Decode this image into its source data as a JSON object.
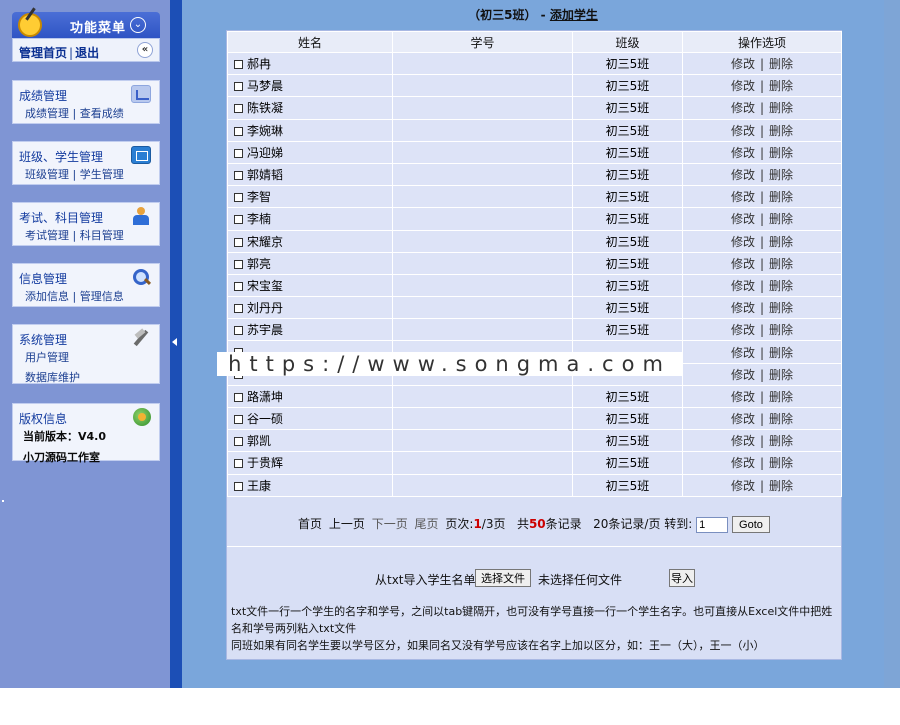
{
  "sidebar": {
    "menu_title": "功能菜单",
    "nav": {
      "home": "管理首页",
      "logout": "退出"
    },
    "panels": [
      {
        "title": "成绩管理",
        "links": [
          "成绩管理",
          "查看成绩"
        ],
        "icon": "chart-icon"
      },
      {
        "title": "班级、学生管理",
        "links": [
          "班级管理",
          "学生管理"
        ],
        "icon": "edit-icon"
      },
      {
        "title": "考试、科目管理",
        "links": [
          "考试管理",
          "科目管理"
        ],
        "icon": "teacher-icon"
      },
      {
        "title": "信息管理",
        "links": [
          "添加信息",
          "管理信息"
        ],
        "icon": "search-icon"
      },
      {
        "title": "系统管理",
        "links": [
          "用户管理",
          "数据库维护"
        ],
        "icon": "tools-icon"
      },
      {
        "title": "版权信息",
        "links": [
          "当前版本：V4.0",
          "小刀源码工作室"
        ],
        "icon": "globe-icon"
      }
    ]
  },
  "main": {
    "class_name": "（初三5班）",
    "separator": "-",
    "add_student": "添加学生",
    "columns": [
      "姓名",
      "学号",
      "班级",
      "操作选项"
    ],
    "op_edit": "修改",
    "op_delete": "删除",
    "op_sep": "|",
    "rows": [
      {
        "name": "郝冉",
        "id": "",
        "class": "初三5班"
      },
      {
        "name": "马梦晨",
        "id": "",
        "class": "初三5班"
      },
      {
        "name": "陈铁凝",
        "id": "",
        "class": "初三5班"
      },
      {
        "name": "李婉琳",
        "id": "",
        "class": "初三5班"
      },
      {
        "name": "冯迎娣",
        "id": "",
        "class": "初三5班"
      },
      {
        "name": "郭婧韬",
        "id": "",
        "class": "初三5班"
      },
      {
        "name": "李智",
        "id": "",
        "class": "初三5班"
      },
      {
        "name": "李楠",
        "id": "",
        "class": "初三5班"
      },
      {
        "name": "宋耀京",
        "id": "",
        "class": "初三5班"
      },
      {
        "name": "郭亮",
        "id": "",
        "class": "初三5班"
      },
      {
        "name": "宋宝玺",
        "id": "",
        "class": "初三5班"
      },
      {
        "name": "刘丹丹",
        "id": "",
        "class": "初三5班"
      },
      {
        "name": "苏宇晨",
        "id": "",
        "class": "初三5班"
      },
      {
        "name": "",
        "id": "",
        "class": ""
      },
      {
        "name": "",
        "id": "",
        "class": ""
      },
      {
        "name": "路潇坤",
        "id": "",
        "class": "初三5班"
      },
      {
        "name": "谷一硕",
        "id": "",
        "class": "初三5班"
      },
      {
        "name": "郭凯",
        "id": "",
        "class": "初三5班"
      },
      {
        "name": "于贵辉",
        "id": "",
        "class": "初三5班"
      },
      {
        "name": "王康",
        "id": "",
        "class": "初三5班"
      }
    ],
    "pager": {
      "first": "首页",
      "prev": "上一页",
      "next": "下一页",
      "last": "尾页",
      "page_label": "页次:",
      "page_current": "1",
      "page_total": "/3页",
      "total_prefix": "共",
      "total_count": "50",
      "total_suffix": "条记录",
      "per_page": "20条记录/页",
      "goto_label": "转到:",
      "goto_value": "1",
      "goto_button": "Goto"
    },
    "import": {
      "label": "从txt导入学生名单",
      "choose_file": "选择文件",
      "no_file": "未选择任何文件",
      "import_button": "导入"
    },
    "notes": [
      "txt文件一行一个学生的名字和学号，之间以tab键隔开，也可没有学号直接一行一个学生名字。也可直接从Excel文件中把姓名和学号两列粘入txt文件",
      "同班如果有同名学生要以学号区分，如果同名又没有学号应该在名字上加以区分，如：王一（大），王一（小）"
    ]
  },
  "watermark": "https://www.songma.com"
}
